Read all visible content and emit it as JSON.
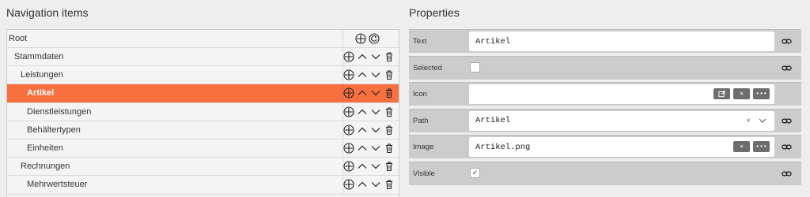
{
  "nav": {
    "heading": "Navigation items",
    "items": [
      {
        "label": "Root",
        "indent": 0,
        "type": "root"
      },
      {
        "label": "Stammdaten",
        "indent": 1
      },
      {
        "label": "Leistungen",
        "indent": 2
      },
      {
        "label": "Artikel",
        "indent": 3,
        "selected": true
      },
      {
        "label": "Dienstleistungen",
        "indent": 3
      },
      {
        "label": "Behältertypen",
        "indent": 3
      },
      {
        "label": "Einheiten",
        "indent": 3
      },
      {
        "label": "Rechnungen",
        "indent": 2
      },
      {
        "label": "Mehrwertsteuer",
        "indent": 3
      }
    ]
  },
  "props": {
    "heading": "Properties",
    "text_label": "Text",
    "text_value": "Artikel",
    "selected_label": "Selected",
    "icon_label": "Icon",
    "path_label": "Path",
    "path_value": "Artikel",
    "path_clear": "×",
    "image_label": "Image",
    "image_value": "Artikel.png",
    "visible_label": "Visible",
    "visible_check": "✓"
  },
  "colors": {
    "selected_row": "#f97040",
    "button_gray": "#6d6d6d"
  }
}
